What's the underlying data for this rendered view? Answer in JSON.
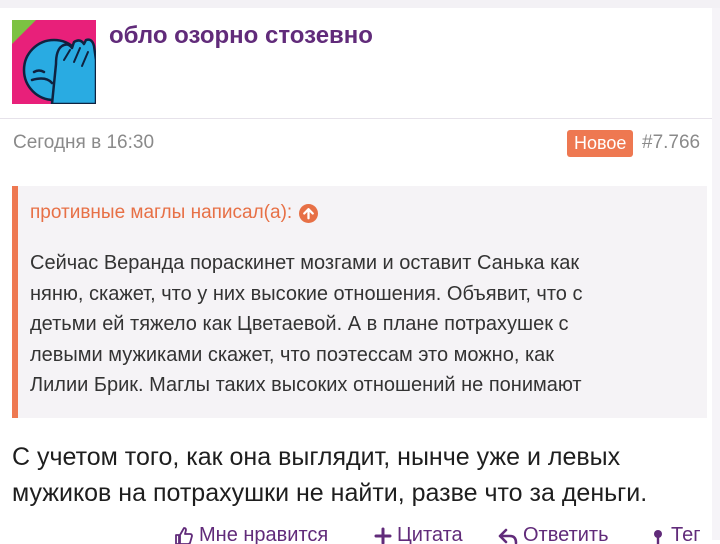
{
  "post": {
    "username": "обло озорно стозевно",
    "timestamp": "Сегодня в 16:30",
    "badge": "Новое",
    "number": "#7.766"
  },
  "quote": {
    "author_label": "противные маглы написал(а):",
    "lines": [
      "Сейчас Веранда пораскинет мозгами и оставит Санька как",
      "няню, скажет, что у них высокие отношения. Объявит, что с",
      "детьми ей тяжело как Цветаевой. А в плане потрахушек с",
      "левыми мужиками скажет, что поэтессам это можно, как",
      "Лилии Брик. Маглы таких высоких отношений не понимают"
    ]
  },
  "reply": {
    "lines": [
      "С учетом того, как она выглядит, нынче уже и левых",
      "мужиков на потрахушки не найти, разве что за деньги."
    ]
  },
  "actions": {
    "like": "Мне нравится",
    "quote": "Цитата",
    "reply": "Ответить",
    "tag": "Тег"
  },
  "icons": {
    "avatar": "facepalm-emoji-avatar",
    "quote_source": "arrow-up-circle-icon",
    "like": "thumbs-up-icon",
    "quote": "plus-icon",
    "reply": "reply-arrow-icon",
    "tag": "tag-icon"
  },
  "colors": {
    "username": "#612b7a",
    "accent": "#ee7851",
    "badge_bg": "#ee7851",
    "meta_text": "#8a8a8a",
    "quote_bg": "#f5f3f6",
    "body_text": "#1e1e1e",
    "avatar_bg": "#e8207a",
    "avatar_corner": "#7cc242",
    "avatar_face": "#29abe2"
  }
}
